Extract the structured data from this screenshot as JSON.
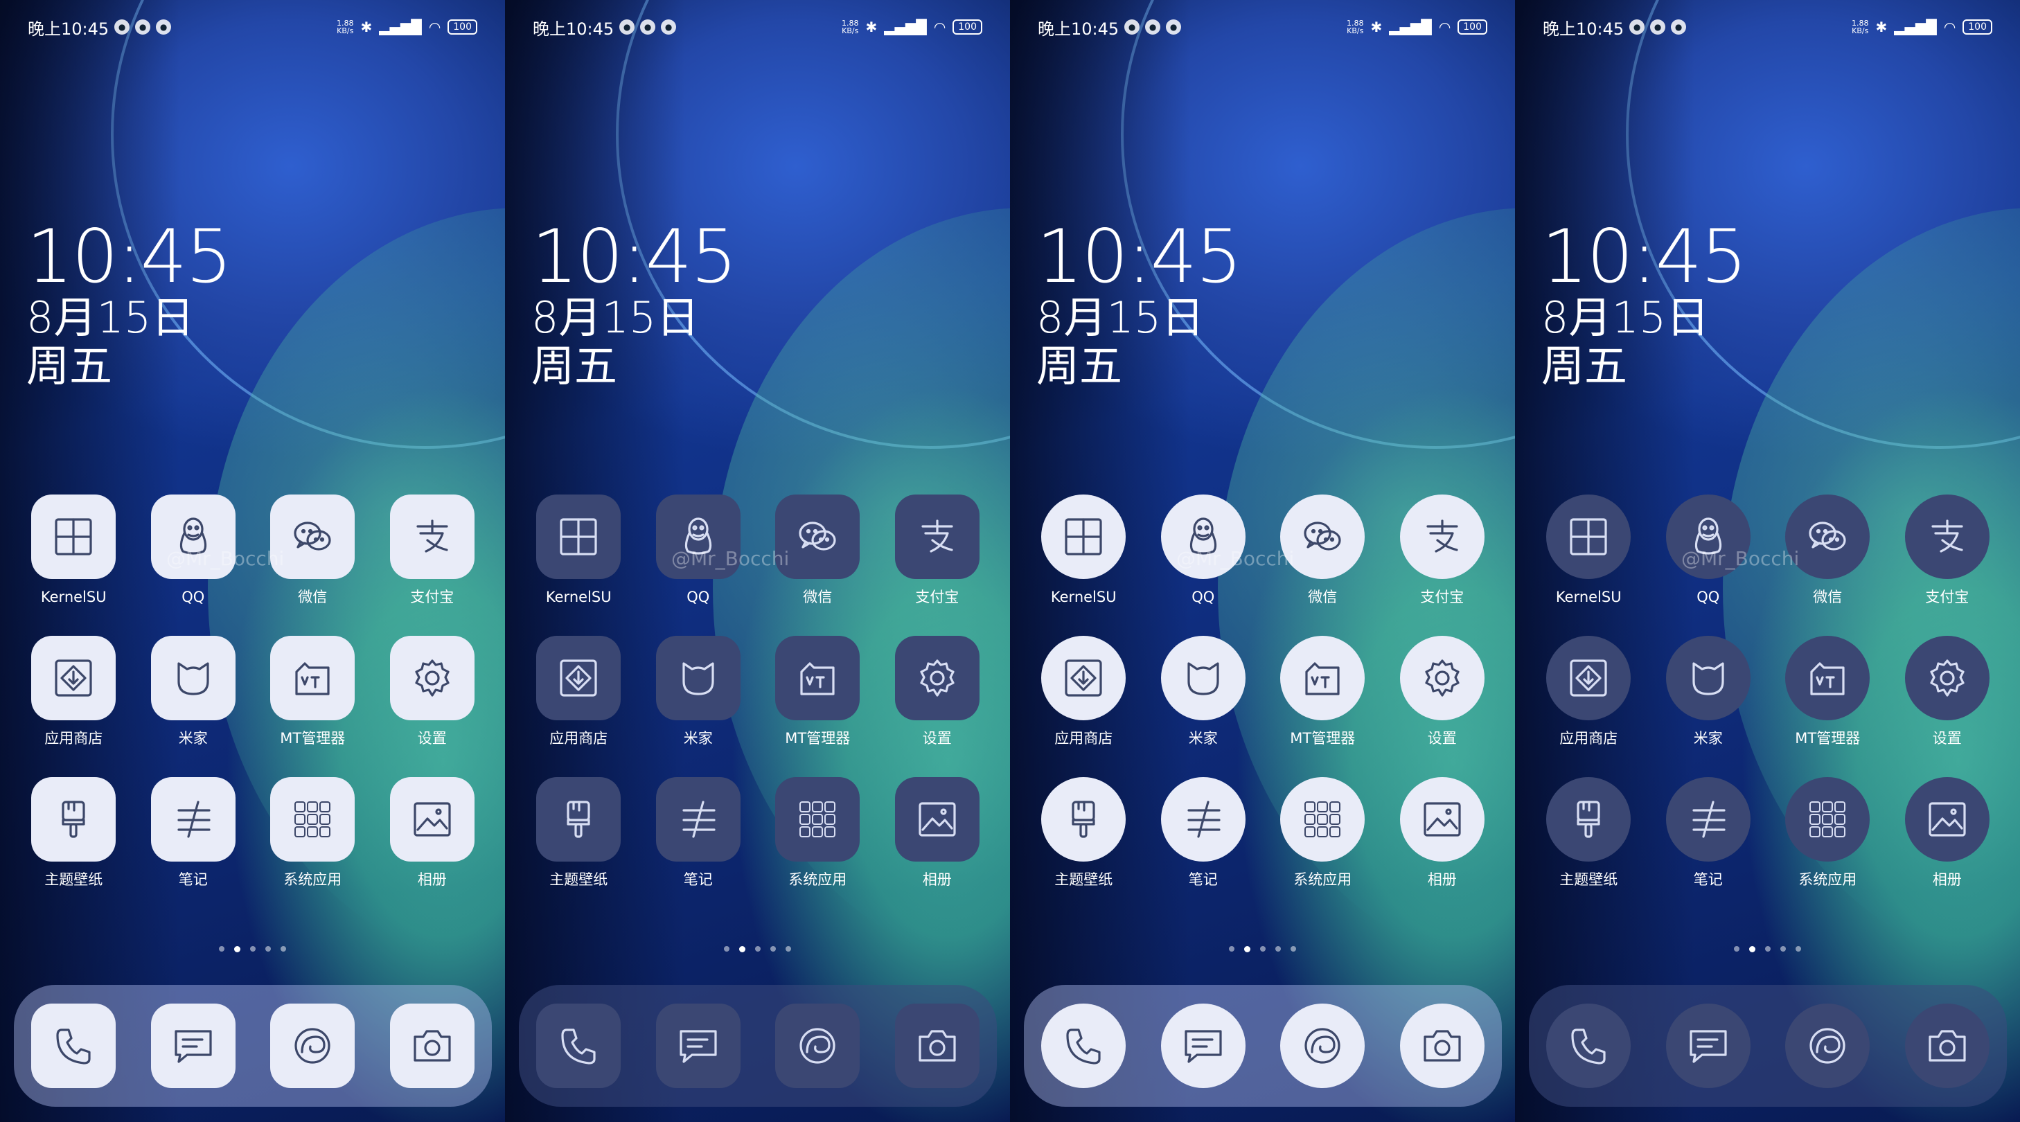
{
  "status": {
    "time": "晚上10:45",
    "speed": "1.88\nKB/s",
    "battery": "100"
  },
  "clock": {
    "time": "10:45",
    "date": "8月15日",
    "weekday": "周五"
  },
  "watermark": "@Mr_Bocchi",
  "apps": [
    {
      "label": "KernelSU",
      "icon": "grid-icon"
    },
    {
      "label": "QQ",
      "icon": "penguin-icon"
    },
    {
      "label": "微信",
      "icon": "wechat-icon"
    },
    {
      "label": "支付宝",
      "icon": "alipay-icon"
    },
    {
      "label": "应用商店",
      "icon": "app-store-icon"
    },
    {
      "label": "米家",
      "icon": "mijia-icon"
    },
    {
      "label": "MT管理器",
      "icon": "mt-manager-icon"
    },
    {
      "label": "设置",
      "icon": "gear-icon"
    },
    {
      "label": "主题壁纸",
      "icon": "brush-icon"
    },
    {
      "label": "笔记",
      "icon": "notes-icon"
    },
    {
      "label": "系统应用",
      "icon": "folder-icon"
    },
    {
      "label": "相册",
      "icon": "gallery-icon"
    }
  ],
  "dock": [
    {
      "icon": "phone-icon"
    },
    {
      "icon": "message-icon"
    },
    {
      "icon": "browser-icon"
    },
    {
      "icon": "camera-icon"
    }
  ],
  "page_indicator": {
    "count": 5,
    "active": 1
  },
  "screens": [
    "squircle-light",
    "squircle-dark",
    "circle-light",
    "circle-dark"
  ]
}
